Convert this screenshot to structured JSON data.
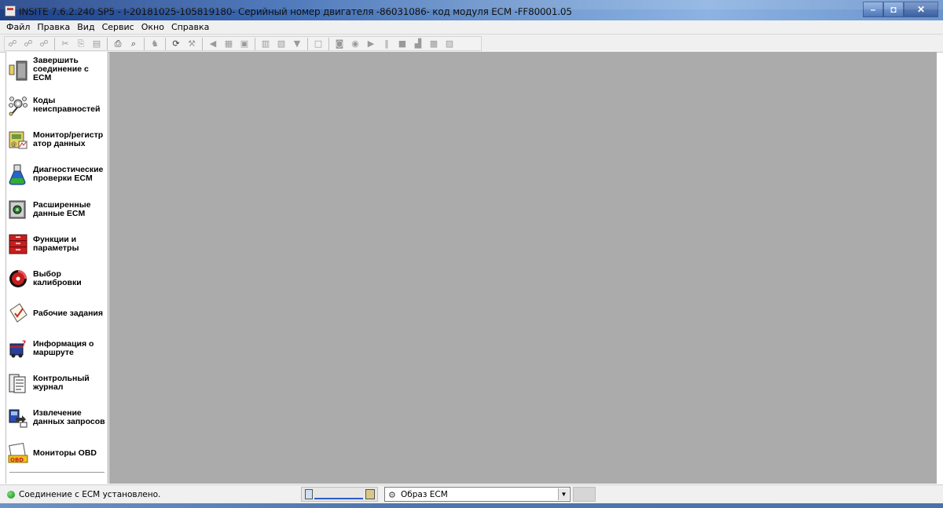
{
  "window": {
    "title": "INSITE 7.6.2.240 SP5 - I-20181025-105819180- Серийный номер двигателя -86031086- код модуля ECM -FF80001.05",
    "icon": "app-icon",
    "controls": {
      "minimize": "–",
      "maximize": "◘",
      "close": "✕"
    }
  },
  "menubar": {
    "items": [
      "Файл",
      "Правка",
      "Вид",
      "Сервис",
      "Окно",
      "Справка"
    ]
  },
  "toolbar": {
    "buttons": [
      {
        "icon": "connect-icon",
        "glyph": "☍",
        "active": false
      },
      {
        "icon": "connect-multi-icon",
        "glyph": "☍",
        "active": false
      },
      {
        "icon": "disconnect-icon",
        "glyph": "☍",
        "active": false
      },
      {
        "sep": true
      },
      {
        "icon": "cut-icon",
        "glyph": "✂",
        "active": false
      },
      {
        "icon": "copy-icon",
        "glyph": "⎘",
        "active": false
      },
      {
        "icon": "paste-icon",
        "glyph": "▤",
        "active": false
      },
      {
        "sep": true
      },
      {
        "icon": "print-icon",
        "glyph": "⎙",
        "active": true
      },
      {
        "icon": "print-preview-icon",
        "glyph": "⌕",
        "active": true
      },
      {
        "sep": true
      },
      {
        "icon": "find-icon",
        "glyph": "♞",
        "active": false
      },
      {
        "sep": true
      },
      {
        "icon": "refresh-icon",
        "glyph": "⟳",
        "active": true
      },
      {
        "icon": "wrench-icon",
        "glyph": "⚒",
        "active": false
      },
      {
        "sep": true
      },
      {
        "icon": "speaker-icon",
        "glyph": "◀",
        "active": false
      },
      {
        "icon": "add-record-icon",
        "glyph": "▦",
        "active": false
      },
      {
        "icon": "save-record-icon",
        "glyph": "▣",
        "active": false
      },
      {
        "sep": true
      },
      {
        "icon": "report-icon",
        "glyph": "▥",
        "active": false
      },
      {
        "icon": "export-icon",
        "glyph": "▧",
        "active": false
      },
      {
        "icon": "filter-icon",
        "glyph": "▼",
        "active": false
      },
      {
        "sep": true
      },
      {
        "icon": "new-doc-icon",
        "glyph": "□",
        "active": false
      },
      {
        "sep": true
      },
      {
        "icon": "camera-icon",
        "glyph": "◙",
        "active": false
      },
      {
        "icon": "record-icon",
        "glyph": "◉",
        "active": false
      },
      {
        "icon": "play-icon",
        "glyph": "▶",
        "active": false
      },
      {
        "icon": "pause-icon",
        "glyph": "‖",
        "active": false
      },
      {
        "icon": "stop-icon",
        "glyph": "■",
        "active": false
      },
      {
        "icon": "step-icon",
        "glyph": "▟",
        "active": false
      },
      {
        "icon": "chart-icon",
        "glyph": "▩",
        "active": false
      },
      {
        "icon": "notes-icon",
        "glyph": "▨",
        "active": false
      }
    ]
  },
  "sidebar": {
    "items": [
      {
        "label": "Завершить\nсоединение с\nECM",
        "icon": "disconnect-ecm-icon"
      },
      {
        "label": "Коды\nнеисправностей",
        "icon": "fault-codes-icon"
      },
      {
        "label": "Монитор/регистр\nатор данных",
        "icon": "data-monitor-icon"
      },
      {
        "label": "Диагностические\nпроверки ECM",
        "icon": "diagnostic-tests-icon"
      },
      {
        "label": "Расширенные\nданные ECM",
        "icon": "advanced-ecm-data-icon"
      },
      {
        "label": "Функции и\nпараметры",
        "icon": "features-parameters-icon"
      },
      {
        "label": "Выбор\nкалибровки",
        "icon": "calibration-selection-icon"
      },
      {
        "label": "Рабочие задания",
        "icon": "work-orders-icon"
      },
      {
        "label": "Информация о\nмаршруте",
        "icon": "trip-information-icon"
      },
      {
        "label": "Контрольный\nжурнал",
        "icon": "audit-trail-icon"
      },
      {
        "label": "Извлечение\nданных запросов",
        "icon": "data-extraction-icon"
      },
      {
        "label": "Мониторы OBD",
        "icon": "obd-monitors-icon"
      }
    ]
  },
  "statusbar": {
    "connection_text": "Соединение с ECM установлено.",
    "connection_state_color": "#1a9a1a",
    "ecm_image_select": {
      "value": "Образ ECM",
      "icon": "ecm-image-icon"
    }
  },
  "colors": {
    "workspace_bg": "#ababab",
    "title_gradient_start": "#1d3f86",
    "title_gradient_end": "#8db3e2"
  }
}
